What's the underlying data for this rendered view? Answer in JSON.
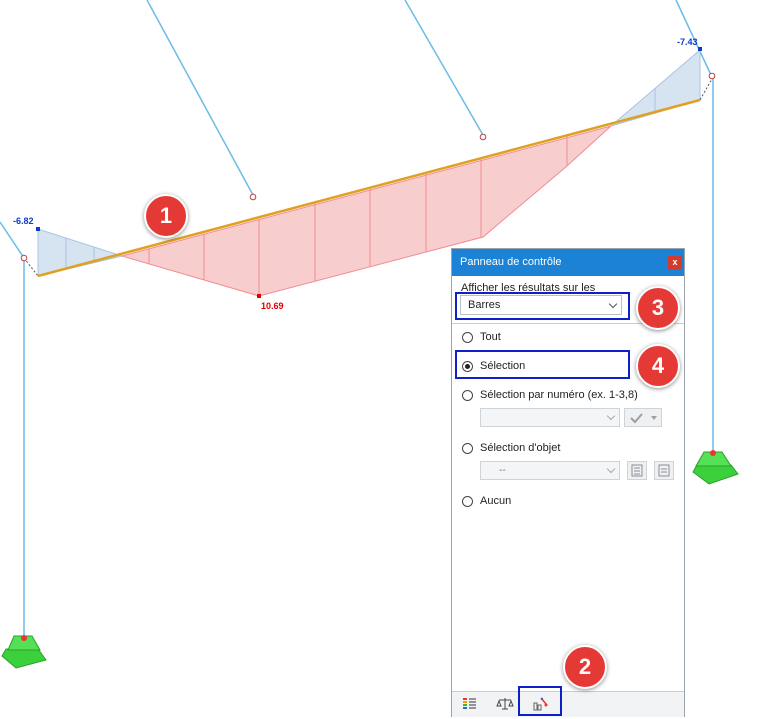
{
  "diagram": {
    "values": [
      {
        "text": "-6.82",
        "style": "blue"
      },
      {
        "text": "10.69",
        "style": "red"
      },
      {
        "text": "-7.43",
        "style": "blue"
      }
    ]
  },
  "badges": [
    "1",
    "2",
    "3",
    "4"
  ],
  "panel": {
    "title": "Panneau de contrôle",
    "close_label": "x",
    "show_results_label": "Afficher les résultats sur les",
    "object_type_value": "Barres",
    "options": [
      {
        "label": "Tout",
        "checked": false
      },
      {
        "label": "Sélection",
        "checked": true
      },
      {
        "label": "Sélection par numéro (ex. 1-3,8)",
        "checked": false
      },
      {
        "label": "Sélection d'objet",
        "checked": false
      },
      {
        "label": "Aucun",
        "checked": false
      }
    ],
    "object_select_value": "--",
    "footer_tabs": [
      "color-scale-icon",
      "balance-icon",
      "filter-members-icon"
    ]
  },
  "colors": {
    "member_line": "#6cbbe8",
    "beam": "#e0a020",
    "negative_fill": "#c8d9ec",
    "positive_fill": "#f6c4c6",
    "panel_header": "#1b82d6",
    "badge": "#e53935",
    "highlight": "#1020c8",
    "support": "#3cd03c"
  }
}
